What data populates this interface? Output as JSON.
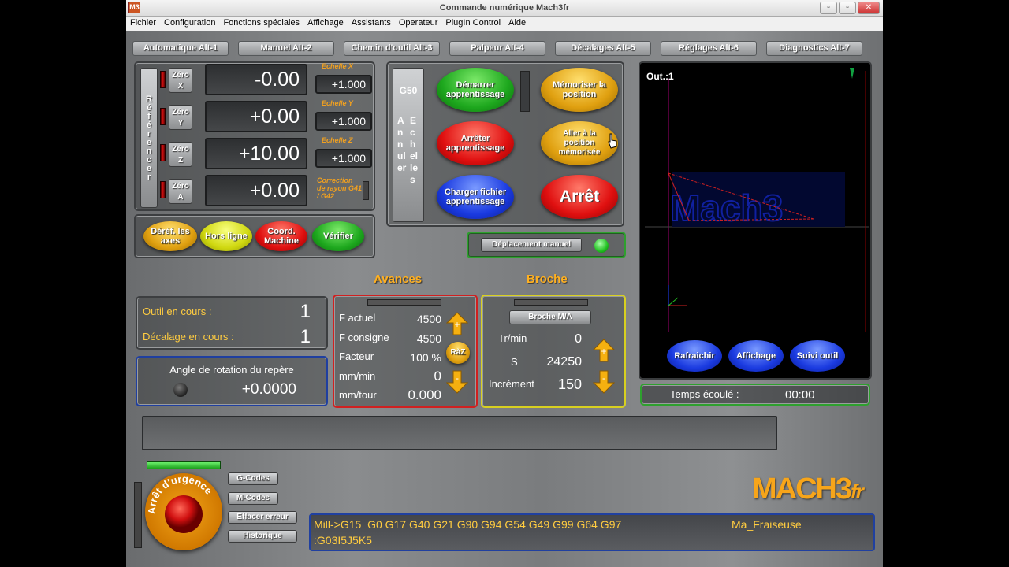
{
  "window": {
    "title": "Commande numérique Mach3fr",
    "app_icon": "M3",
    "minimize": "▫",
    "maximize": "▫",
    "close": "✕"
  },
  "menu": [
    "Fichier",
    "Configuration",
    "Fonctions spéciales",
    "Affichage",
    "Assistants",
    "Operateur",
    "PlugIn Control",
    "Aide"
  ],
  "tabs": [
    "Automatique Alt-1",
    "Manuel Alt-2",
    "Chemin d'outil Alt-3",
    "Palpeur Alt-4",
    "Décalages Alt-5",
    "Réglages Alt-6",
    "Diagnostics Alt-7"
  ],
  "axes": {
    "ref_label": "Référencer",
    "rows": [
      {
        "zero_line1": "Zéro",
        "zero_line2": "X",
        "value": "-0.00",
        "scale_label": "Echelle X",
        "scale": "+1.000"
      },
      {
        "zero_line1": "Zéro",
        "zero_line2": "Y",
        "value": "+0.00",
        "scale_label": "Echelle Y",
        "scale": "+1.000"
      },
      {
        "zero_line1": "Zéro",
        "zero_line2": "Z",
        "value": "+10.00",
        "scale_label": "Echelle Z",
        "scale": "+1.000"
      },
      {
        "zero_line1": "Zéro",
        "zero_line2": "A",
        "value": "+0.00"
      }
    ],
    "radius_label": "Correction de rayon G41 / G42"
  },
  "axis_buttons": {
    "deref": "Déréf. les axes",
    "offline": "Hors ligne",
    "machine": "Coord. Machine",
    "verify": "Vérifier"
  },
  "teach": {
    "g50": "G50",
    "annuler": "Annuler",
    "echelles": "Echelles",
    "start": "Démarrer apprentissage",
    "stop": "Arrêter apprentissage",
    "load": "Charger fichier apprentissage",
    "memorize": "Mémoriser la position",
    "goto": "Aller à la position mémorisée",
    "arret": "Arrêt"
  },
  "jog": {
    "label": "Déplacement manuel"
  },
  "toolpath": {
    "out_label": "Out.:1",
    "refresh": "Rafraichir",
    "display": "Affichage",
    "follow": "Suivi outil",
    "logo_text": "Mach3"
  },
  "elapsed": {
    "label": "Temps écoulé :",
    "value": "00:00"
  },
  "tool": {
    "current_label": "Outil en cours :",
    "current": "1",
    "offset_label": "Décalage en cours :",
    "offset": "1"
  },
  "rotation": {
    "label": "Angle de rotation du repère",
    "value": "+0.0000"
  },
  "feeds": {
    "title": "Avances",
    "f_actuel_label": "F actuel",
    "f_actuel": "4500",
    "f_consigne_label": "F consigne",
    "f_consigne": "4500",
    "factor_label": "Facteur",
    "factor": "100 %",
    "mmmin_label": "mm/min",
    "mmmin": "0",
    "mmtour_label": "mm/tour",
    "mmtour": "0.000",
    "raz": "RàZ"
  },
  "spindle": {
    "title": "Broche",
    "toggle": "Broche M/A",
    "rpm_label": "Tr/min",
    "rpm": "0",
    "s_label": "S",
    "s": "24250",
    "incr_label": "Incrément",
    "incr": "150"
  },
  "status_message": "",
  "estop": {
    "label": "Arrêt d'urgence"
  },
  "side_buttons": [
    "G-Codes",
    "M-Codes",
    "Effacer erreur",
    "Historique"
  ],
  "brand": {
    "main": "MACH3",
    "suffix": "fr"
  },
  "gcode": {
    "line1": "Mill->G15  G0 G17 G40 G21 G90 G94 G54 G49 G99 G64 G97",
    "line2": ":G03I5J5K5",
    "profile": "Ma_Fraiseuse"
  },
  "cursor": "hand-pointer"
}
